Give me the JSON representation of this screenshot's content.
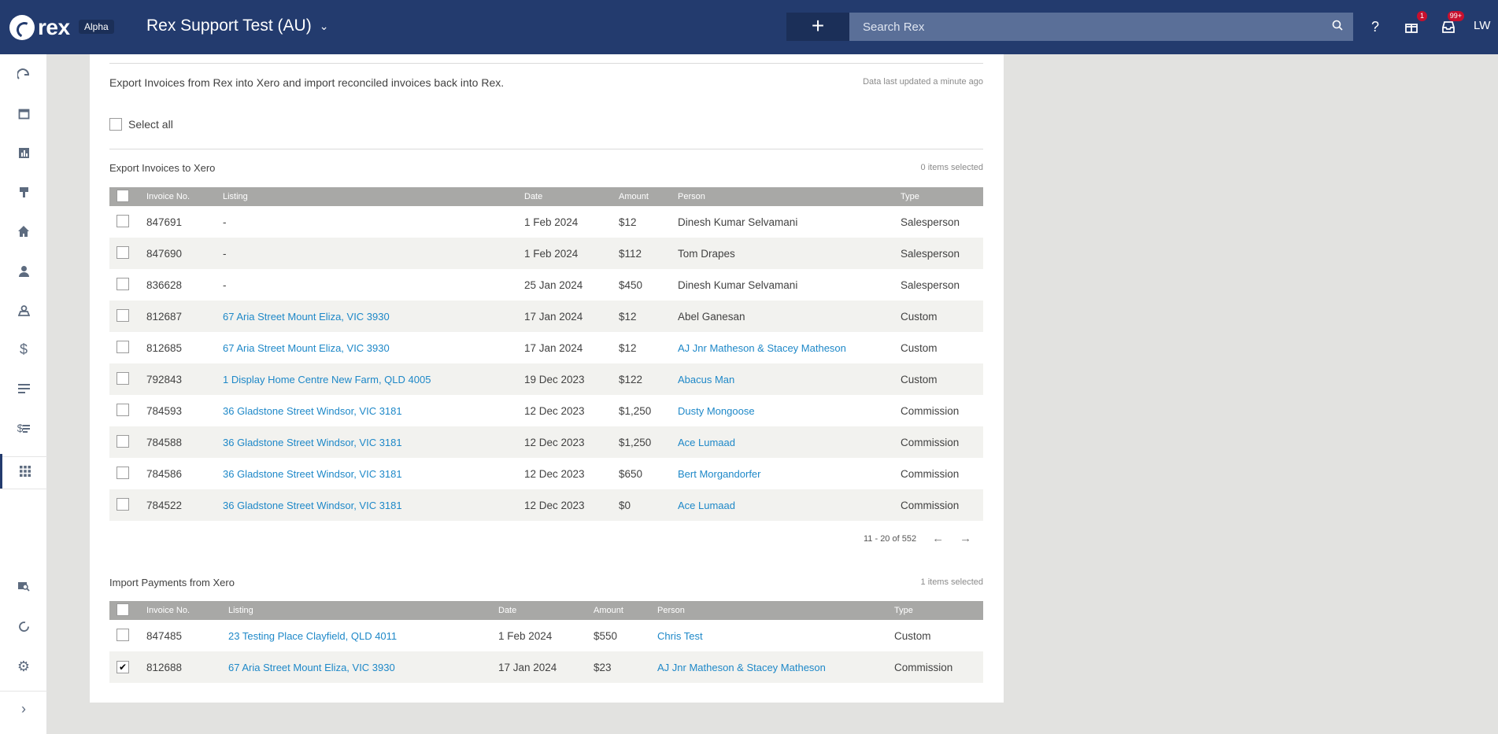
{
  "topbar": {
    "logo_text": "rex",
    "alpha": "Alpha",
    "account": "Rex Support Test (AU)",
    "plus": "+",
    "search_placeholder": "Search Rex",
    "help": "?",
    "gift_badge": "1",
    "inbox_badge": "99+",
    "initials": "LW"
  },
  "page": {
    "intro": "Export Invoices from Rex into Xero and import reconciled invoices back into Rex.",
    "updated": "Data last updated a minute ago",
    "select_all": "Select all"
  },
  "export": {
    "title": "Export Invoices to Xero",
    "count": "0 items selected",
    "headers": [
      "Invoice No.",
      "Listing",
      "Date",
      "Amount",
      "Person",
      "Type"
    ],
    "rows": [
      {
        "invoice": "847691",
        "listing": "-",
        "listing_link": false,
        "date": "1 Feb 2024",
        "amount": "$12",
        "person": "Dinesh Kumar Selvamani",
        "person_link": false,
        "type": "Salesperson",
        "checked": false
      },
      {
        "invoice": "847690",
        "listing": "-",
        "listing_link": false,
        "date": "1 Feb 2024",
        "amount": "$112",
        "person": "Tom Drapes",
        "person_link": false,
        "type": "Salesperson",
        "checked": false
      },
      {
        "invoice": "836628",
        "listing": "-",
        "listing_link": false,
        "date": "25 Jan 2024",
        "amount": "$450",
        "person": "Dinesh Kumar Selvamani",
        "person_link": false,
        "type": "Salesperson",
        "checked": false
      },
      {
        "invoice": "812687",
        "listing": "67 Aria Street Mount Eliza, VIC 3930",
        "listing_link": true,
        "date": "17 Jan 2024",
        "amount": "$12",
        "person": "Abel Ganesan",
        "person_link": false,
        "type": "Custom",
        "checked": false
      },
      {
        "invoice": "812685",
        "listing": "67 Aria Street Mount Eliza, VIC 3930",
        "listing_link": true,
        "date": "17 Jan 2024",
        "amount": "$12",
        "person": "AJ Jnr Matheson & Stacey Matheson",
        "person_link": true,
        "type": "Custom",
        "checked": false
      },
      {
        "invoice": "792843",
        "listing": "1 Display Home Centre New Farm, QLD 4005",
        "listing_link": true,
        "date": "19 Dec 2023",
        "amount": "$122",
        "person": "Abacus Man",
        "person_link": true,
        "type": "Custom",
        "checked": false
      },
      {
        "invoice": "784593",
        "listing": "36 Gladstone Street Windsor, VIC 3181",
        "listing_link": true,
        "date": "12 Dec 2023",
        "amount": "$1,250",
        "person": "Dusty Mongoose",
        "person_link": true,
        "type": "Commission",
        "checked": false
      },
      {
        "invoice": "784588",
        "listing": "36 Gladstone Street Windsor, VIC 3181",
        "listing_link": true,
        "date": "12 Dec 2023",
        "amount": "$1,250",
        "person": "Ace Lumaad",
        "person_link": true,
        "type": "Commission",
        "checked": false
      },
      {
        "invoice": "784586",
        "listing": "36 Gladstone Street Windsor, VIC 3181",
        "listing_link": true,
        "date": "12 Dec 2023",
        "amount": "$650",
        "person": "Bert Morgandorfer",
        "person_link": true,
        "type": "Commission",
        "checked": false
      },
      {
        "invoice": "784522",
        "listing": "36 Gladstone Street Windsor, VIC 3181",
        "listing_link": true,
        "date": "12 Dec 2023",
        "amount": "$0",
        "person": "Ace Lumaad",
        "person_link": true,
        "type": "Commission",
        "checked": false
      }
    ],
    "pager": "11 - 20 of 552"
  },
  "import": {
    "title": "Import Payments from Xero",
    "count": "1 items selected",
    "headers": [
      "Invoice No.",
      "Listing",
      "Date",
      "Amount",
      "Person",
      "Type"
    ],
    "rows": [
      {
        "invoice": "847485",
        "listing": "23 Testing Place Clayfield, QLD 4011",
        "listing_link": true,
        "date": "1 Feb 2024",
        "amount": "$550",
        "person": "Chris Test",
        "person_link": true,
        "type": "Custom",
        "checked": false
      },
      {
        "invoice": "812688",
        "listing": "67 Aria Street Mount Eliza, VIC 3930",
        "listing_link": true,
        "date": "17 Jan 2024",
        "amount": "$23",
        "person": "AJ Jnr Matheson & Stacey Matheson",
        "person_link": true,
        "type": "Commission",
        "checked": true
      }
    ]
  },
  "sidebar_icons": [
    "rex-home-icon",
    "calendar-icon",
    "reports-icon",
    "marketing-icon",
    "properties-icon",
    "contacts-icon",
    "leads-icon",
    "finance-icon",
    "lists-icon",
    "billing-icon",
    "apps-grid-icon",
    "search-listings-icon",
    "refresh-icon",
    "settings-icon",
    "expand-icon"
  ],
  "colors": {
    "topbar": "#233b6e",
    "link": "#1e88c8",
    "table_header": "#a8a8a6"
  }
}
